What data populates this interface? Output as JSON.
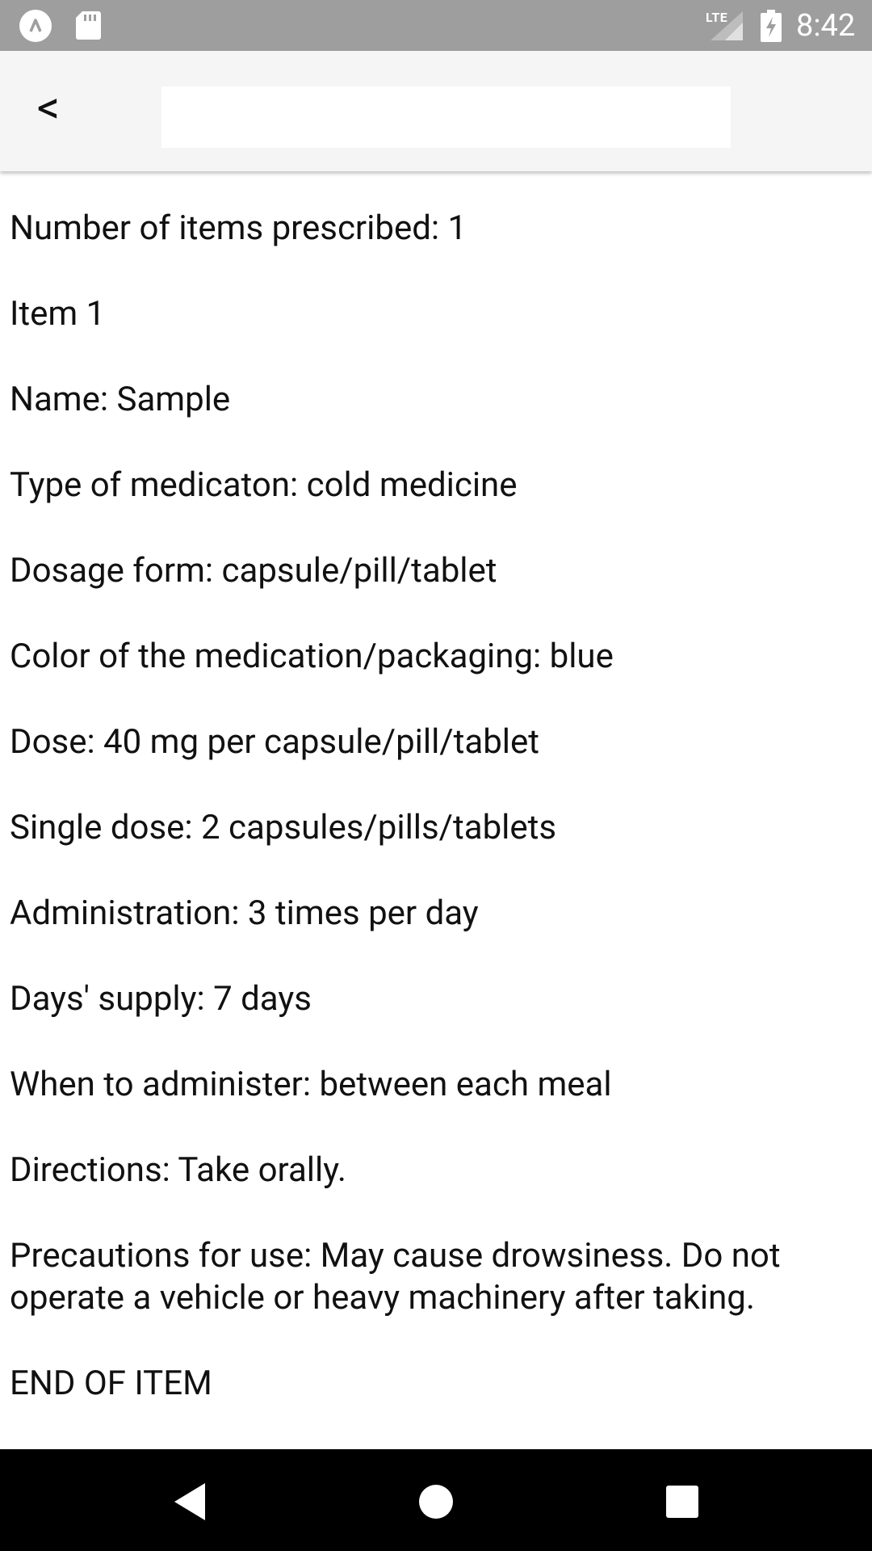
{
  "status_bar": {
    "network_label": "LTE",
    "time": "8:42",
    "icons": [
      "app-notification-icon",
      "sd-card-icon",
      "signal-icon",
      "battery-charging-icon"
    ]
  },
  "toolbar": {
    "back_label": "<",
    "search_value": ""
  },
  "content": {
    "lines": [
      "Number of items prescribed: 1",
      "Item 1",
      "Name: Sample",
      "Type of medicaton: cold medicine",
      "Dosage form: capsule/pill/tablet",
      "Color of the medication/packaging: blue",
      "Dose: 40 mg per capsule/pill/tablet",
      "Single dose: 2 capsules/pills/tablets",
      "Administration: 3 times per day",
      "Days' supply: 7 days",
      "When to administer: between each meal",
      "Directions: Take orally.",
      "Precautions for use: May cause drowsiness. Do not operate a vehicle or heavy machinery after taking.",
      "END OF ITEM"
    ]
  },
  "nav_bar": {
    "icons": [
      "nav-back-icon",
      "nav-home-icon",
      "nav-recent-icon"
    ]
  },
  "colors": {
    "status_bar": "#9e9e9e",
    "toolbar": "#f5f5f5",
    "nav_bar": "#000000",
    "text": "#111111"
  }
}
